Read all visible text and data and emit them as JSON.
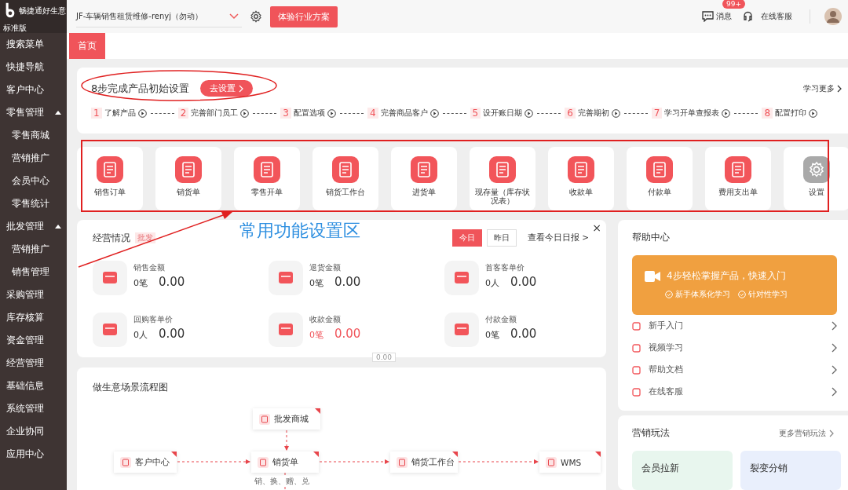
{
  "brand": {
    "name": "畅捷通好生意",
    "edition": "标准版"
  },
  "sidebar": {
    "items": [
      {
        "label": "搜索菜单"
      },
      {
        "label": "快捷导航"
      },
      {
        "label": "客户中心"
      },
      {
        "label": "零售管理",
        "expanded": true,
        "children": [
          {
            "label": "零售商城"
          },
          {
            "label": "营销推广"
          },
          {
            "label": "会员中心"
          },
          {
            "label": "零售统计"
          }
        ]
      },
      {
        "label": "批发管理",
        "expanded": true,
        "children": [
          {
            "label": "营销推广"
          },
          {
            "label": "销售管理"
          }
        ]
      },
      {
        "label": "采购管理"
      },
      {
        "label": "库存核算"
      },
      {
        "label": "资金管理"
      },
      {
        "label": "经营管理"
      },
      {
        "label": "基础信息"
      },
      {
        "label": "系统管理"
      },
      {
        "label": "企业协同"
      },
      {
        "label": "应用中心"
      }
    ]
  },
  "topbar": {
    "account": "JF-车辆销售租赁维修-renyj（勿动）",
    "trial_button": "体验行业方案",
    "messages": "消息",
    "badge": "99+",
    "service": "在线客服"
  },
  "tabs": [
    {
      "label": "首页",
      "selected": true
    }
  ],
  "setup": {
    "title": "8步完成产品初始设置",
    "button": "去设置",
    "more": "学习更多",
    "steps": [
      {
        "number": "1",
        "label": "了解产品"
      },
      {
        "number": "2",
        "label": "完善部门员工"
      },
      {
        "number": "3",
        "label": "配置选项"
      },
      {
        "number": "4",
        "label": "完善商品客户"
      },
      {
        "number": "5",
        "label": "设开账日期"
      },
      {
        "number": "6",
        "label": "完善期初"
      },
      {
        "number": "7",
        "label": "学习开单查报表"
      },
      {
        "number": "8",
        "label": "配置打印"
      }
    ]
  },
  "quick_functions": [
    {
      "label": "销售订单",
      "kind": "action"
    },
    {
      "label": "销货单",
      "kind": "action"
    },
    {
      "label": "零售开单",
      "kind": "action"
    },
    {
      "label": "销货工作台",
      "kind": "action"
    },
    {
      "label": "进货单",
      "kind": "action"
    },
    {
      "label": "现存量（库存状况表）",
      "kind": "action"
    },
    {
      "label": "收款单",
      "kind": "action"
    },
    {
      "label": "付款单",
      "kind": "action"
    },
    {
      "label": "费用支出单",
      "kind": "action"
    },
    {
      "label": "设置",
      "kind": "settings"
    }
  ],
  "annotation": {
    "text": "常用功能设置区"
  },
  "business": {
    "title": "经营情况",
    "tag": "批发",
    "periods": [
      {
        "label": "今日",
        "selected": true
      },
      {
        "label": "昨日",
        "selected": false
      }
    ],
    "report_link": "查看今日日报 >",
    "close": "×",
    "metrics": [
      {
        "label": "销售金额",
        "count": "0笔",
        "amount": "0.00",
        "highlighted": false
      },
      {
        "label": "退货金额",
        "count": "0笔",
        "amount": "0.00",
        "highlighted": false
      },
      {
        "label": "首客客单价",
        "count": "0人",
        "amount": "0.00",
        "highlighted": false
      },
      {
        "label": "回购客单价",
        "count": "0人",
        "amount": "0.00",
        "highlighted": false
      },
      {
        "label": "收款金额",
        "count": "0笔",
        "amount": "0.00",
        "highlighted": true
      },
      {
        "label": "付款金额",
        "count": "0笔",
        "amount": "0.00",
        "highlighted": false
      }
    ],
    "floating_value": "0.00"
  },
  "flow": {
    "title": "做生意场景流程图",
    "nodes": [
      {
        "label": "批发商城"
      },
      {
        "label": "客户中心"
      },
      {
        "label": "销货单"
      },
      {
        "label": "销货工作台"
      },
      {
        "label": "WMS"
      }
    ],
    "edge_label": "销、换、赠、兑"
  },
  "help": {
    "title": "帮助中心",
    "banner": {
      "title": "4步轻松掌握产品，快速入门",
      "points": [
        "新手体系化学习",
        "针对性学习"
      ]
    },
    "links": [
      {
        "label": "新手入门"
      },
      {
        "label": "视频学习"
      },
      {
        "label": "帮助文档"
      },
      {
        "label": "在线客服"
      }
    ]
  },
  "marketing": {
    "title": "营销玩法",
    "more": "更多营销玩法",
    "tiles": [
      {
        "label": "会员拉新",
        "color": "#e8f6ee"
      },
      {
        "label": "裂变分销",
        "color": "#e9effc"
      }
    ]
  }
}
